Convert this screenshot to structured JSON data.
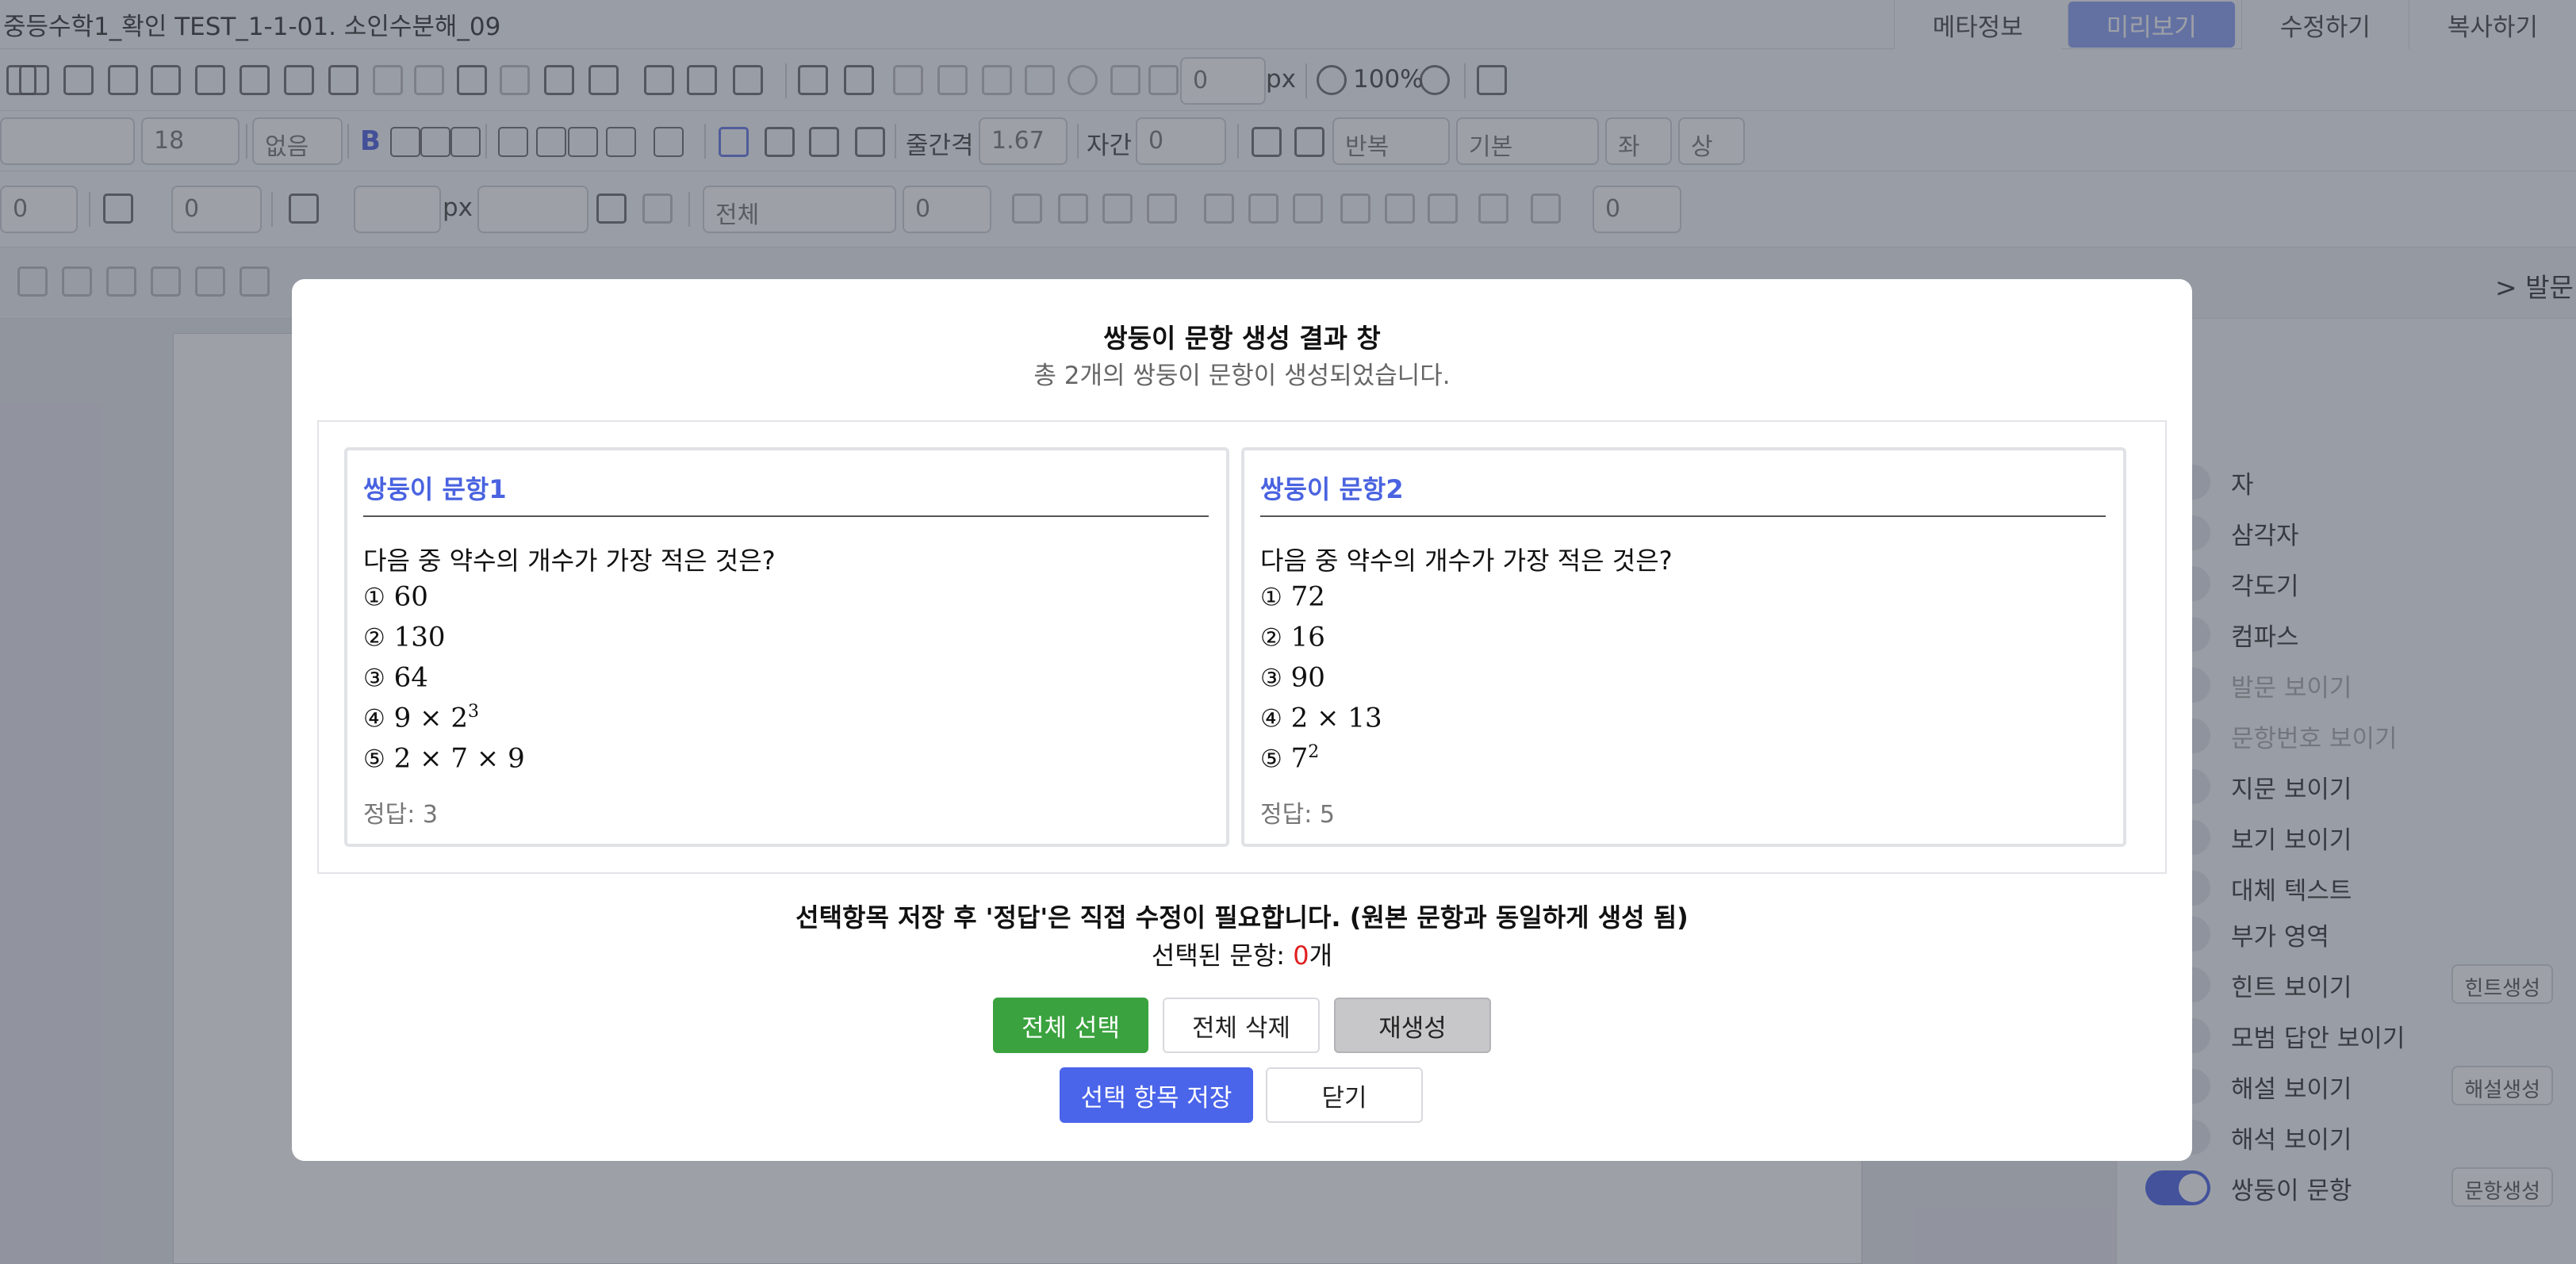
{
  "app": {
    "doc_title": "중등수학1_확인 TEST_1-1-01. 소인수분해_09",
    "tabs": [
      "메타정보",
      "미리보기",
      "수정하기",
      "복사하기"
    ],
    "active_tab": "미리보기"
  },
  "toolbar": {
    "width_value": "0",
    "width_unit": "px",
    "zoom": "100%",
    "font_size": "18",
    "font_none": "없음",
    "line_height_label": "줄간격",
    "line_height_value": "1.67",
    "letter_spacing_label": "자간",
    "letter_spacing_value": "0",
    "repeat_select": "반복",
    "basic_select": "기본",
    "align_h": "좌",
    "align_v": "상",
    "row3_input1": "0",
    "row3_input2": "0",
    "row3_px": "px",
    "row3_all": "전체",
    "row3_input3": "0",
    "row3_input4": "0"
  },
  "right_fragment": "> 발문",
  "side_panel": {
    "items": [
      {
        "label": "자",
        "on": false,
        "dim": false
      },
      {
        "label": "삼각자",
        "on": false,
        "dim": false
      },
      {
        "label": "각도기",
        "on": false,
        "dim": false
      },
      {
        "label": "컴파스",
        "on": false,
        "dim": false
      },
      {
        "label": "발문 보이기",
        "on": false,
        "dim": true
      },
      {
        "label": "문항번호 보이기",
        "on": false,
        "dim": true
      },
      {
        "label": "지문 보이기",
        "on": false,
        "dim": false
      },
      {
        "label": "보기 보이기",
        "on": false,
        "dim": false
      },
      {
        "label": "대체 텍스트",
        "on": false,
        "dim": false
      },
      {
        "label": "부가 영역",
        "on": false,
        "dim": false
      },
      {
        "label": "힌트 보이기",
        "on": false,
        "dim": false,
        "button": "힌트생성"
      },
      {
        "label": "모범 답안 보이기",
        "on": false,
        "dim": false
      },
      {
        "label": "해설 보이기",
        "on": false,
        "dim": false,
        "button": "해설생성"
      },
      {
        "label": "해석 보이기",
        "on": false,
        "dim": false
      },
      {
        "label": "쌍둥이 문항",
        "on": true,
        "dim": false,
        "button": "문항생성"
      }
    ]
  },
  "modal": {
    "title": "쌍둥이 문항 생성 결과 창",
    "subtitle": "총 2개의 쌍둥이 문항이 생성되었습니다.",
    "cards": [
      {
        "title": "쌍둥이 문항1",
        "question": "다음 중 약수의 개수가 가장 적은 것은?",
        "options": [
          {
            "marker": "①",
            "text": "60",
            "sup": ""
          },
          {
            "marker": "②",
            "text": "130",
            "sup": ""
          },
          {
            "marker": "③",
            "text": "64",
            "sup": ""
          },
          {
            "marker": "④",
            "text": "9 × 2",
            "sup": "3"
          },
          {
            "marker": "⑤",
            "text": "2 × 7 × 9",
            "sup": ""
          }
        ],
        "answer": "정답: 3"
      },
      {
        "title": "쌍둥이 문항2",
        "question": "다음 중 약수의 개수가 가장 적은 것은?",
        "options": [
          {
            "marker": "①",
            "text": "72",
            "sup": ""
          },
          {
            "marker": "②",
            "text": "16",
            "sup": ""
          },
          {
            "marker": "③",
            "text": "90",
            "sup": ""
          },
          {
            "marker": "④",
            "text": "2 × 13",
            "sup": ""
          },
          {
            "marker": "⑤",
            "text": "7",
            "sup": "2"
          }
        ],
        "answer": "정답: 5"
      }
    ],
    "note": "선택항목 저장 후 '정답'은 직접 수정이 필요합니다. (원본 문항과 동일하게 생성 됨)",
    "selected_prefix": "선택된 문항: ",
    "selected_count": "0",
    "selected_suffix": "개",
    "buttons": {
      "select_all": "전체 선택",
      "delete_all": "전체 삭제",
      "regenerate": "재생성",
      "save_selected": "선택 항목 저장",
      "close": "닫기"
    }
  }
}
